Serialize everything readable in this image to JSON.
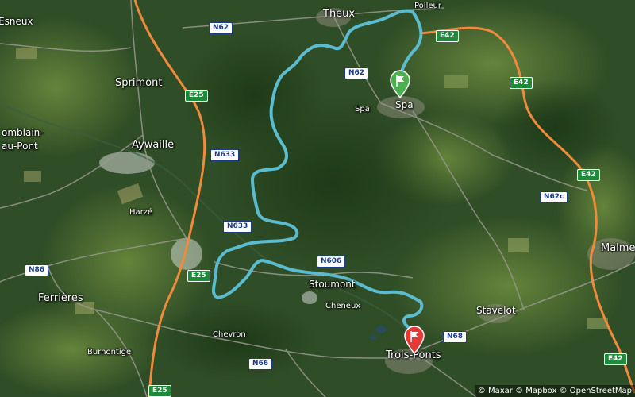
{
  "map": {
    "places": [
      {
        "id": "esneux",
        "label": "Esneux"
      },
      {
        "id": "theux",
        "label": "Theux"
      },
      {
        "id": "polleur",
        "label": "Polleur"
      },
      {
        "id": "sprimont",
        "label": "Sprimont"
      },
      {
        "id": "spa-left",
        "label": "Spa"
      },
      {
        "id": "spa",
        "label": "Spa"
      },
      {
        "id": "comblain",
        "label": "omblain-"
      },
      {
        "id": "comblain2",
        "label": "au-Pont"
      },
      {
        "id": "aywaille",
        "label": "Aywaille"
      },
      {
        "id": "harze",
        "label": "Harzé"
      },
      {
        "id": "malmedy",
        "label": "Malme"
      },
      {
        "id": "ferrieres",
        "label": "Ferrières"
      },
      {
        "id": "stoumont",
        "label": "Stoumont"
      },
      {
        "id": "cheneux",
        "label": "Cheneux"
      },
      {
        "id": "stavelot",
        "label": "Stavelot"
      },
      {
        "id": "chevron",
        "label": "Chevron"
      },
      {
        "id": "burnontige",
        "label": "Burnontige"
      },
      {
        "id": "troisponts",
        "label": "Trois-Ponts"
      }
    ],
    "shields": [
      {
        "id": "n62-top",
        "label": "N62",
        "kind": "n"
      },
      {
        "id": "e42-top",
        "label": "E42",
        "kind": "e"
      },
      {
        "id": "n62-mid",
        "label": "N62",
        "kind": "n"
      },
      {
        "id": "e42-right1",
        "label": "E42",
        "kind": "e"
      },
      {
        "id": "e25-top",
        "label": "E25",
        "kind": "e"
      },
      {
        "id": "n633-a",
        "label": "N633",
        "kind": "n"
      },
      {
        "id": "e42-right2",
        "label": "E42",
        "kind": "e"
      },
      {
        "id": "n62c",
        "label": "N62c",
        "kind": "n"
      },
      {
        "id": "n633-b",
        "label": "N633",
        "kind": "n"
      },
      {
        "id": "n86",
        "label": "N86",
        "kind": "n"
      },
      {
        "id": "e25-mid",
        "label": "E25",
        "kind": "e"
      },
      {
        "id": "n606",
        "label": "N606",
        "kind": "n"
      },
      {
        "id": "n68",
        "label": "N68",
        "kind": "n"
      },
      {
        "id": "n66",
        "label": "N66",
        "kind": "n"
      },
      {
        "id": "e42-bottom",
        "label": "E42",
        "kind": "e"
      },
      {
        "id": "e25-bottom",
        "label": "E25",
        "kind": "e"
      }
    ],
    "start_marker": {
      "color": "#4caf50",
      "icon": "flag-icon"
    },
    "end_marker": {
      "color": "#e53935",
      "icon": "flag-icon"
    },
    "route_color": "#5bbcd0",
    "motorway_color": "#f08a3c",
    "attribution": "© Maxar © Mapbox © OpenStreetMap"
  }
}
